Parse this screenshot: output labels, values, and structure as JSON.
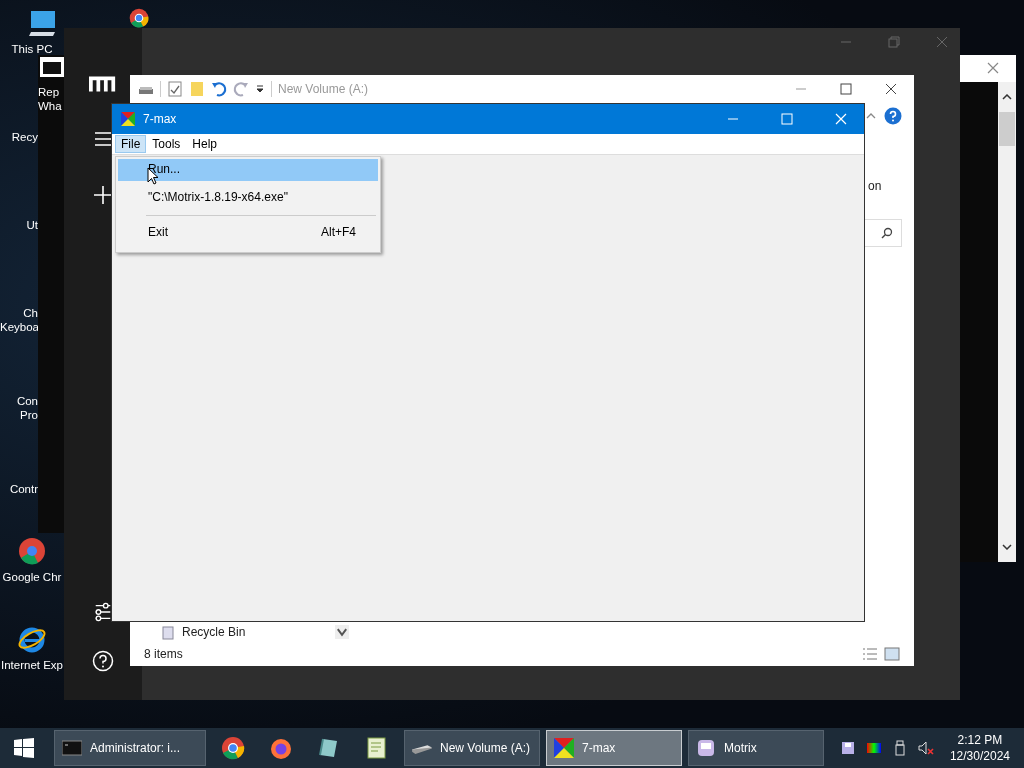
{
  "desktop": {
    "icons": [
      {
        "label": "This PC"
      },
      {
        "label": "Recy"
      },
      {
        "label": "Ut"
      },
      {
        "label": "Ch Keyboa"
      },
      {
        "label": "Con Pro"
      },
      {
        "label": "Contr"
      },
      {
        "label": "Google Chr"
      },
      {
        "label": "Internet Exp"
      }
    ],
    "shortcut": {
      "label": "Rep Wha"
    }
  },
  "explorer": {
    "title": "New Volume (A:)",
    "ribbon_text": "on",
    "nav_items": [
      {
        "label": "Recycle Bin"
      }
    ],
    "status": "8 items"
  },
  "seven_max": {
    "title": "7-max",
    "menu": [
      {
        "label": "File",
        "selected": true
      },
      {
        "label": "Tools",
        "selected": false
      },
      {
        "label": "Help",
        "selected": false
      }
    ],
    "dropdown": [
      {
        "kind": "item",
        "label": "Run...",
        "selected": true
      },
      {
        "kind": "item",
        "label": "\"C:\\Motrix-1.8.19-x64.exe\"",
        "selected": false
      },
      {
        "kind": "separator"
      },
      {
        "kind": "item",
        "label": "Exit",
        "shortcut": "Alt+F4",
        "selected": false
      }
    ]
  },
  "taskbar": {
    "tasks": [
      {
        "kind": "window",
        "label": "Administrator: i...",
        "selected": false
      },
      {
        "kind": "pinned"
      },
      {
        "kind": "pinned"
      },
      {
        "kind": "pinned"
      },
      {
        "kind": "pinned"
      },
      {
        "kind": "window",
        "label": "New Volume (A:)",
        "selected": false
      },
      {
        "kind": "window",
        "label": "7-max",
        "selected": true
      },
      {
        "kind": "window",
        "label": "Motrix",
        "selected": false
      }
    ],
    "time": "2:12 PM",
    "date": "12/30/2024"
  }
}
